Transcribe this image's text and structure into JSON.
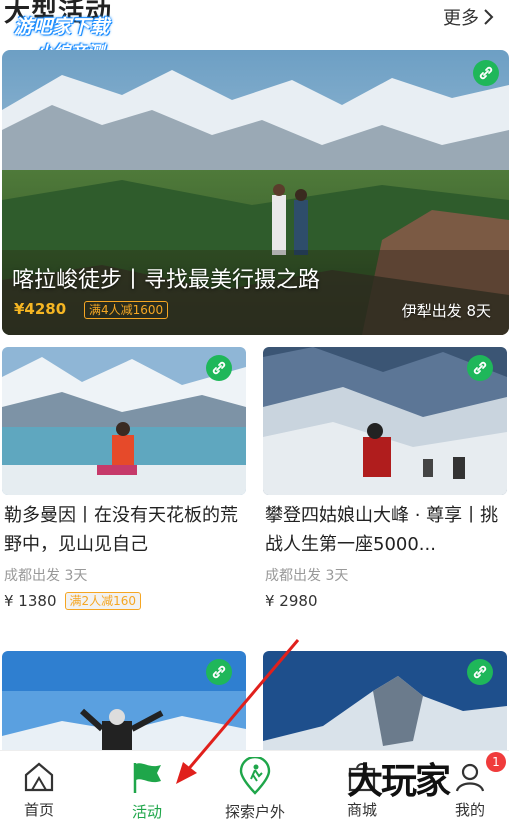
{
  "header": {
    "title": "大型活动",
    "more_label": "更多",
    "watermark_line1": "游吧家下载",
    "watermark_line2": "小编亲测"
  },
  "hero": {
    "title": "喀拉峻徒步丨寻找最美行摄之路",
    "price": "¥4280",
    "promo": "满4人减1600",
    "meta": "伊犁出发 8天",
    "icon": "link-icon"
  },
  "cards": [
    {
      "title": "勒多曼因丨在没有天花板的荒野中，见山见自己",
      "meta": "成都出发 3天",
      "price": "¥ 1380",
      "promo": "满2人减160"
    },
    {
      "title": "攀登四姑娘山大峰 · 尊享丨挑战人生第一座5000...",
      "meta": "成都出发 3天",
      "price": "¥ 2980",
      "promo": ""
    },
    {
      "title": "",
      "meta": "",
      "price": "",
      "promo": ""
    },
    {
      "title": "",
      "meta": "",
      "price": "",
      "promo": ""
    }
  ],
  "tabbar": {
    "tabs": [
      {
        "label": "首页",
        "icon": "home-icon"
      },
      {
        "label": "活动",
        "icon": "flag-icon",
        "active": true
      },
      {
        "label": "探索户外",
        "icon": "explore-pin-icon"
      },
      {
        "label": "商城",
        "icon": "shop-icon"
      },
      {
        "label": "我的",
        "icon": "profile-icon"
      }
    ],
    "notification_count": "1",
    "watermark": "大玩家"
  },
  "colors": {
    "accent_green": "#1fa64a",
    "promo_orange": "#f5a623",
    "badge_red": "#f03b3b",
    "annotation_arrow": "#e0201c"
  }
}
